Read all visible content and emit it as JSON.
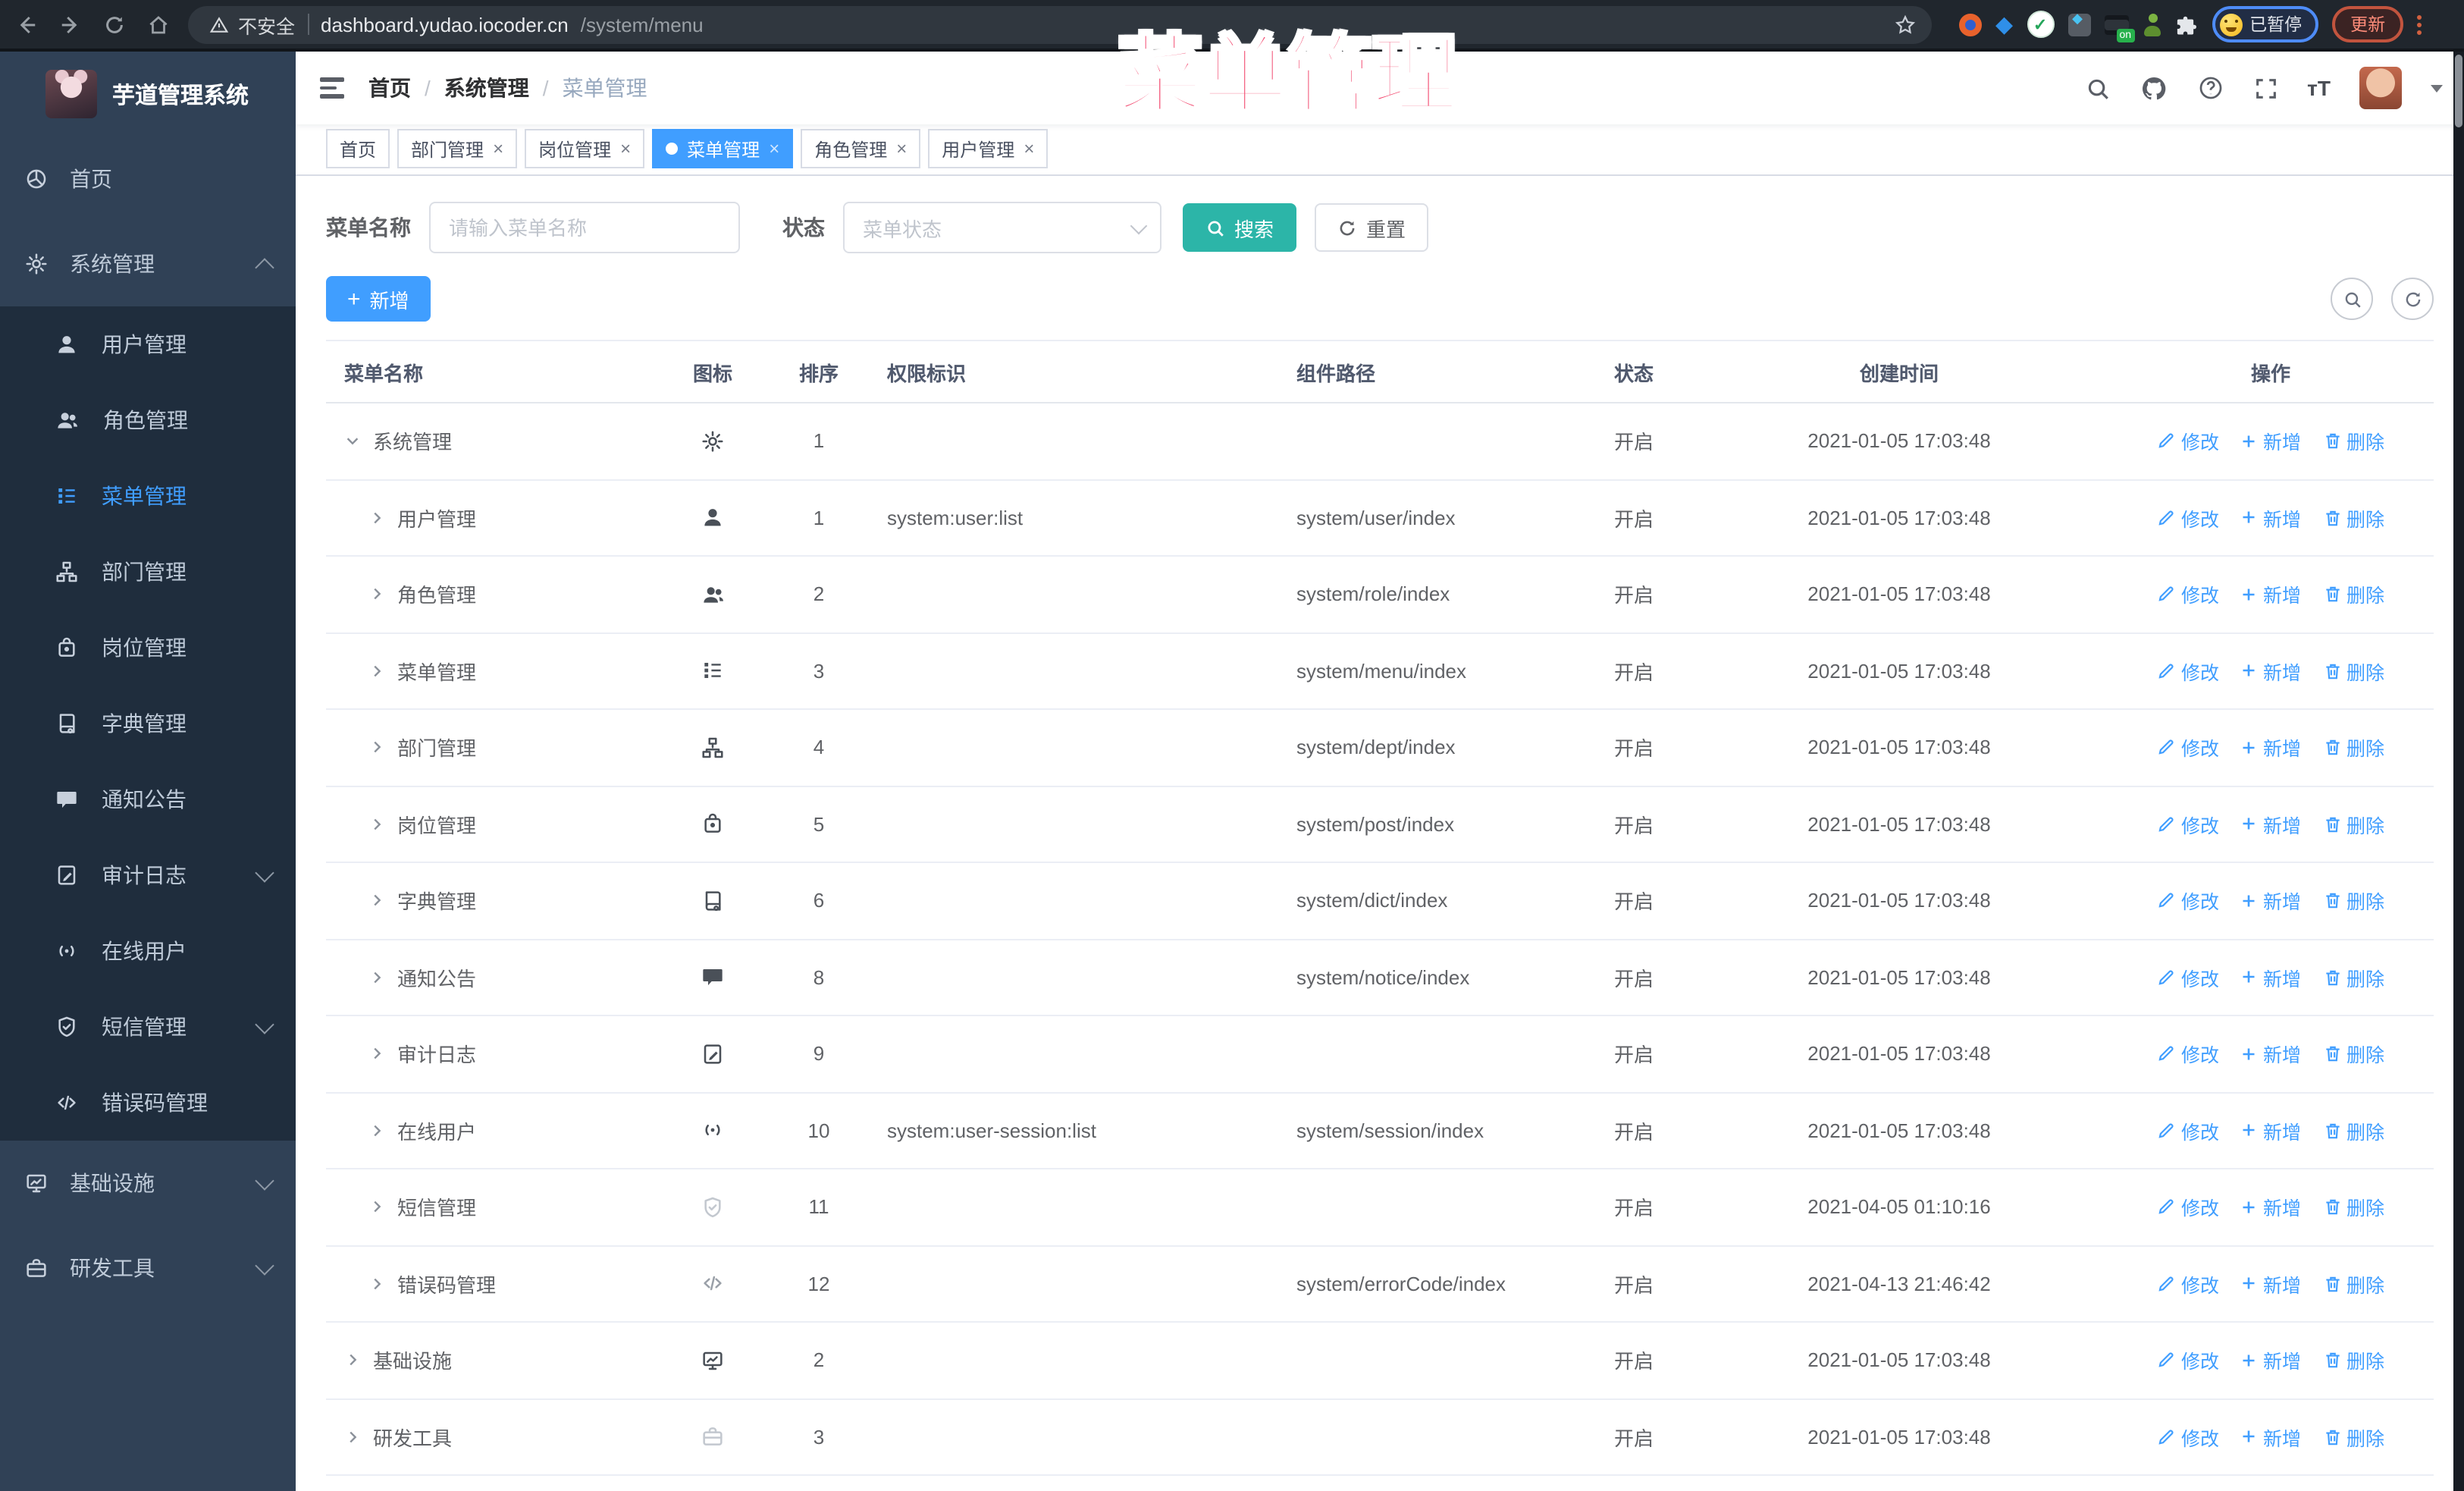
{
  "colors": {
    "primary": "#409eff",
    "teal": "#2cb5a8",
    "overlay_pink": "#f2446b",
    "sidebar_bg": "#304156",
    "submenu_bg": "#1f2d3d",
    "active_tab": "#409eff"
  },
  "overlay_title": "菜单管理",
  "browser": {
    "security_label": "不安全",
    "url_host": "dashboard.yudao.iocoder.cn",
    "url_path": "/system/menu",
    "paused_badge": "已暂停",
    "update_button": "更新",
    "extensions": [
      "bookmark-star",
      "orange-donut-extension",
      "blue-gem-extension",
      "green-shield-extension",
      "panel-extension",
      "list-on-extension",
      "green-avatar-extension",
      "extensions-puzzle",
      "paused-profile-badge",
      "update-button",
      "overflow-menu"
    ]
  },
  "sidebar": {
    "app_title": "芋道管理系统",
    "items": [
      {
        "label": "首页",
        "icon": "dashboard",
        "level": 0
      },
      {
        "label": "系统管理",
        "icon": "gear",
        "level": 0,
        "arrow": "up",
        "active_parent": true
      },
      {
        "label": "用户管理",
        "icon": "user",
        "level": 1
      },
      {
        "label": "角色管理",
        "icon": "users",
        "level": 1
      },
      {
        "label": "菜单管理",
        "icon": "menu",
        "level": 1,
        "active": true
      },
      {
        "label": "部门管理",
        "icon": "tree",
        "level": 1
      },
      {
        "label": "岗位管理",
        "icon": "post",
        "level": 1
      },
      {
        "label": "字典管理",
        "icon": "dict",
        "level": 1
      },
      {
        "label": "通知公告",
        "icon": "message",
        "level": 1
      },
      {
        "label": "审计日志",
        "icon": "log",
        "level": 1,
        "arrow": "down"
      },
      {
        "label": "在线用户",
        "icon": "online",
        "level": 1
      },
      {
        "label": "短信管理",
        "icon": "shield",
        "level": 1,
        "arrow": "down"
      },
      {
        "label": "错误码管理",
        "icon": "code",
        "level": 1
      },
      {
        "label": "基础设施",
        "icon": "infra",
        "level": 0,
        "arrow": "down"
      },
      {
        "label": "研发工具",
        "icon": "tool",
        "level": 0,
        "arrow": "down"
      }
    ]
  },
  "header": {
    "breadcrumb": [
      "首页",
      "系统管理",
      "菜单管理"
    ],
    "right_icons": [
      "search-icon",
      "github-icon",
      "help-icon",
      "fullscreen-icon",
      "font-size-icon"
    ]
  },
  "tabs": [
    {
      "label": "首页",
      "closable": false,
      "active": false
    },
    {
      "label": "部门管理",
      "closable": true,
      "active": false
    },
    {
      "label": "岗位管理",
      "closable": true,
      "active": false
    },
    {
      "label": "菜单管理",
      "closable": true,
      "active": true
    },
    {
      "label": "角色管理",
      "closable": true,
      "active": false
    },
    {
      "label": "用户管理",
      "closable": true,
      "active": false
    }
  ],
  "filters": {
    "name_label": "菜单名称",
    "name_placeholder": "请输入菜单名称",
    "status_label": "状态",
    "status_placeholder": "菜单状态",
    "search_label": "搜索",
    "reset_label": "重置"
  },
  "toolbar": {
    "add_label": "新增"
  },
  "table": {
    "columns": [
      "菜单名称",
      "图标",
      "排序",
      "权限标识",
      "组件路径",
      "状态",
      "创建时间",
      "操作"
    ],
    "action_labels": [
      "修改",
      "新增",
      "删除"
    ],
    "rows": [
      {
        "name": "系统管理",
        "level": 0,
        "caret": "down",
        "icon": "gear",
        "tone": "dark",
        "sort": "1",
        "perm": "",
        "path": "",
        "status": "开启",
        "time": "2021-01-05 17:03:48"
      },
      {
        "name": "用户管理",
        "level": 1,
        "caret": "right",
        "icon": "user",
        "tone": "dark",
        "sort": "1",
        "perm": "system:user:list",
        "path": "system/user/index",
        "status": "开启",
        "time": "2021-01-05 17:03:48"
      },
      {
        "name": "角色管理",
        "level": 1,
        "caret": "right",
        "icon": "users",
        "tone": "dark",
        "sort": "2",
        "perm": "",
        "path": "system/role/index",
        "status": "开启",
        "time": "2021-01-05 17:03:48"
      },
      {
        "name": "菜单管理",
        "level": 1,
        "caret": "right",
        "icon": "menu",
        "tone": "dark",
        "sort": "3",
        "perm": "",
        "path": "system/menu/index",
        "status": "开启",
        "time": "2021-01-05 17:03:48"
      },
      {
        "name": "部门管理",
        "level": 1,
        "caret": "right",
        "icon": "tree",
        "tone": "dark",
        "sort": "4",
        "perm": "",
        "path": "system/dept/index",
        "status": "开启",
        "time": "2021-01-05 17:03:48"
      },
      {
        "name": "岗位管理",
        "level": 1,
        "caret": "right",
        "icon": "post",
        "tone": "dark",
        "sort": "5",
        "perm": "",
        "path": "system/post/index",
        "status": "开启",
        "time": "2021-01-05 17:03:48"
      },
      {
        "name": "字典管理",
        "level": 1,
        "caret": "right",
        "icon": "dict",
        "tone": "dark",
        "sort": "6",
        "perm": "",
        "path": "system/dict/index",
        "status": "开启",
        "time": "2021-01-05 17:03:48"
      },
      {
        "name": "通知公告",
        "level": 1,
        "caret": "right",
        "icon": "message",
        "tone": "dark",
        "sort": "8",
        "perm": "",
        "path": "system/notice/index",
        "status": "开启",
        "time": "2021-01-05 17:03:48"
      },
      {
        "name": "审计日志",
        "level": 1,
        "caret": "right",
        "icon": "log",
        "tone": "dark",
        "sort": "9",
        "perm": "",
        "path": "",
        "status": "开启",
        "time": "2021-01-05 17:03:48"
      },
      {
        "name": "在线用户",
        "level": 1,
        "caret": "right",
        "icon": "online",
        "tone": "dark",
        "sort": "10",
        "perm": "system:user-session:list",
        "path": "system/session/index",
        "status": "开启",
        "time": "2021-01-05 17:03:48"
      },
      {
        "name": "短信管理",
        "level": 1,
        "caret": "right",
        "icon": "shield",
        "tone": "light",
        "sort": "11",
        "perm": "",
        "path": "",
        "status": "开启",
        "time": "2021-04-05 01:10:16"
      },
      {
        "name": "错误码管理",
        "level": 1,
        "caret": "right",
        "icon": "code",
        "tone": "mid",
        "sort": "12",
        "perm": "",
        "path": "system/errorCode/index",
        "status": "开启",
        "time": "2021-04-13 21:46:42"
      },
      {
        "name": "基础设施",
        "level": 0,
        "caret": "right",
        "icon": "infra",
        "tone": "dark",
        "sort": "2",
        "perm": "",
        "path": "",
        "status": "开启",
        "time": "2021-01-05 17:03:48"
      },
      {
        "name": "研发工具",
        "level": 0,
        "caret": "right",
        "icon": "tool",
        "tone": "light",
        "sort": "3",
        "perm": "",
        "path": "",
        "status": "开启",
        "time": "2021-01-05 17:03:48"
      }
    ]
  }
}
